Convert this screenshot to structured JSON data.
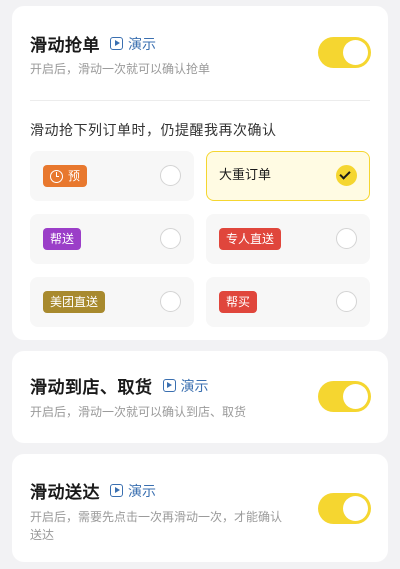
{
  "demo_label": "演示",
  "cards": {
    "grab": {
      "title": "滑动抢单",
      "subtitle": "开启后，滑动一次就可以确认抢单",
      "enabled": true,
      "section_label": "滑动抢下列订单时，仍提醒我再次确认",
      "options": [
        {
          "label": "预",
          "color": "#e8782e",
          "icon": "clock-icon",
          "checked": false
        },
        {
          "label": "大重订单",
          "color": "",
          "icon": "",
          "checked": true
        },
        {
          "label": "帮送",
          "color": "#9b3ec8",
          "icon": "",
          "checked": false
        },
        {
          "label": "专人直送",
          "color": "#e0463c",
          "icon": "",
          "checked": false
        },
        {
          "label": "美团直送",
          "color": "#a88a2e",
          "icon": "",
          "checked": false
        },
        {
          "label": "帮买",
          "color": "#e0463c",
          "icon": "",
          "checked": false
        }
      ]
    },
    "arrive": {
      "title": "滑动到店、取货",
      "subtitle": "开启后，滑动一次就可以确认到店、取货",
      "enabled": true
    },
    "deliver": {
      "title": "滑动送达",
      "subtitle": "开启后，需要先点击一次再滑动一次，才能确认送达",
      "enabled": true
    }
  },
  "colors": {
    "accent": "#f5d630",
    "link": "#3a6fb0"
  }
}
